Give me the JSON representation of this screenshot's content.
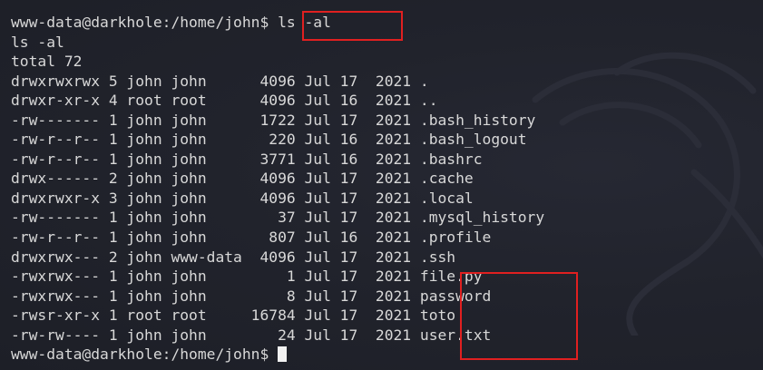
{
  "terminal": {
    "lines": [
      "www-data@darkhole:/home/john$ ls -al",
      "ls -al",
      "total 72",
      "drwxrwxrwx 5 john john      4096 Jul 17  2021 .",
      "drwxr-xr-x 4 root root      4096 Jul 16  2021 ..",
      "-rw------- 1 john john      1722 Jul 17  2021 .bash_history",
      "-rw-r--r-- 1 john john       220 Jul 16  2021 .bash_logout",
      "-rw-r--r-- 1 john john      3771 Jul 16  2021 .bashrc",
      "drwx------ 2 john john      4096 Jul 17  2021 .cache",
      "drwxrwxr-x 3 john john      4096 Jul 17  2021 .local",
      "-rw------- 1 john john        37 Jul 17  2021 .mysql_history",
      "-rw-r--r-- 1 john john       807 Jul 16  2021 .profile",
      "drwxrwx--- 2 john www-data  4096 Jul 17  2021 .ssh",
      "-rwxrwx--- 1 john john         1 Jul 17  2021 file.py",
      "-rwxrwx--- 1 john john         8 Jul 17  2021 password",
      "-rwsr-xr-x 1 root root     16784 Jul 17  2021 toto",
      "-rw-rw---- 1 john john        24 Jul 17  2021 user.txt"
    ],
    "prompt": "www-data@darkhole:/home/john$ "
  },
  "colors": {
    "background": "#1e2029",
    "text": "#d8d8d8",
    "highlight": "#e02020"
  },
  "icons": {
    "watermark": "kali-dragon-icon"
  }
}
